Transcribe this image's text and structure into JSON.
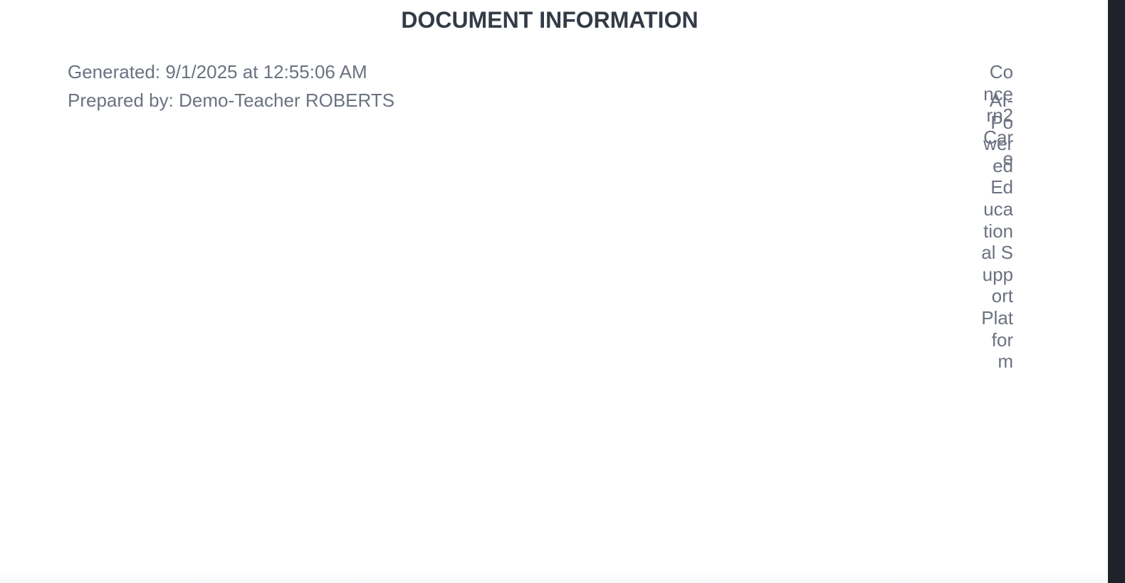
{
  "document": {
    "heading": "DOCUMENT INFORMATION",
    "generated": "Generated: 9/1/2025 at 12:55:06 AM",
    "prepared_by": "Prepared by: Demo-Teacher ROBERTS"
  },
  "footer_labels": {
    "app_name": "Concern2Care",
    "tagline": "AI-Powered Educational Support Platform"
  },
  "colors": {
    "heading": "#343b47",
    "body_text": "#6b7280",
    "background": "#ffffff"
  }
}
